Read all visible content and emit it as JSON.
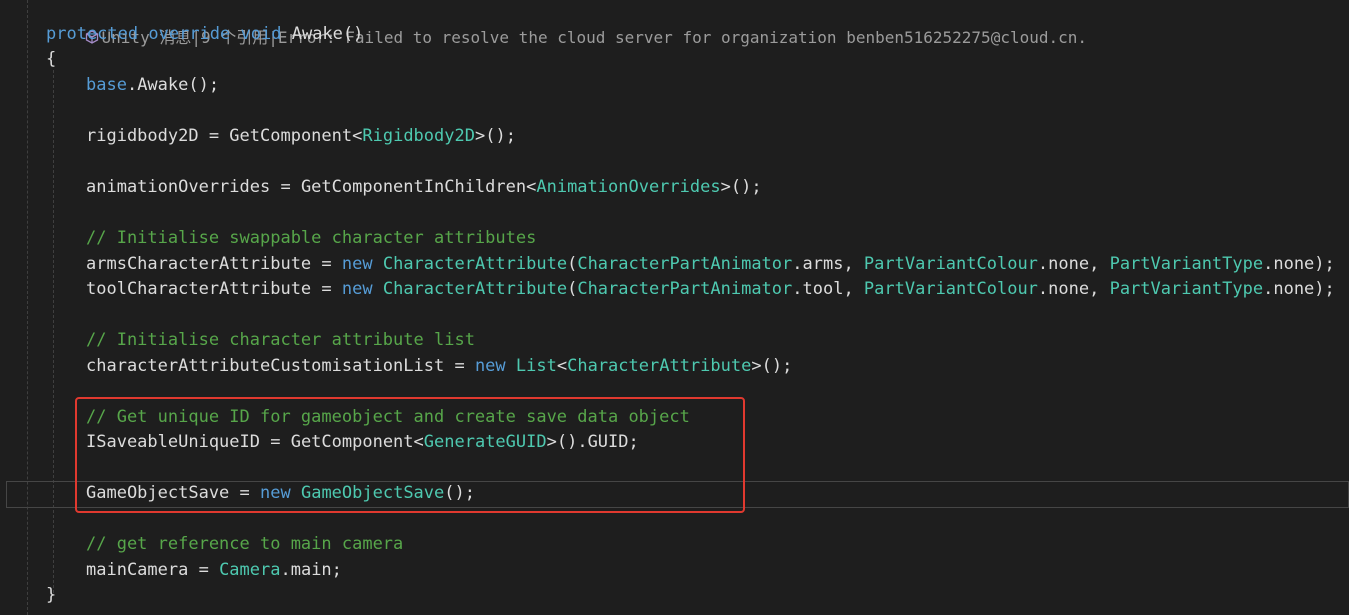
{
  "codelens": {
    "icon": "unity-cube-icon",
    "text": "Unity 消息|9 个引用|Error: Failed to resolve the cloud server for organization benben516252275@cloud.cn."
  },
  "code": {
    "signature": {
      "kw1": "protected",
      "kw2": "override",
      "kw3": "void",
      "name": "Awake",
      "parens": "()"
    },
    "open_brace": "{",
    "base_awake": {
      "kw": "base",
      "rest": ".Awake();"
    },
    "rigidbody": {
      "lhs": "rigidbody2D = ",
      "method": "GetComponent",
      "lt": "<",
      "type": "Rigidbody2D",
      "gt": ">",
      "tail": "();"
    },
    "animation": {
      "lhs": "animationOverrides = ",
      "method": "GetComponentInChildren",
      "lt": "<",
      "type": "AnimationOverrides",
      "gt": ">",
      "tail": "();"
    },
    "comment_swappable": "// Initialise swappable character attributes",
    "arms": {
      "lhs": "armsCharacterAttribute = ",
      "kw": "new",
      "ctor": "CharacterAttribute",
      "p1": "(",
      "t1": "CharacterPartAnimator",
      "m1": ".arms, ",
      "t2": "PartVariantColour",
      "m2": ".none, ",
      "t3": "PartVariantType",
      "m3": ".none);"
    },
    "tool": {
      "lhs": "toolCharacterAttribute = ",
      "kw": "new",
      "ctor": "CharacterAttribute",
      "p1": "(",
      "t1": "CharacterPartAnimator",
      "m1": ".tool, ",
      "t2": "PartVariantColour",
      "m2": ".none, ",
      "t3": "PartVariantType",
      "m3": ".none);"
    },
    "comment_list": "// Initialise character attribute list",
    "customisation": {
      "lhs": "characterAttributeCustomisationList = ",
      "kw": "new",
      "type1": "List",
      "lt": "<",
      "type2": "CharacterAttribute",
      "gt": ">",
      "tail": "();"
    },
    "comment_guid": "// Get unique ID for gameobject and create save data object",
    "guid": {
      "lhs": "ISaveableUniqueID = ",
      "method": "GetComponent",
      "lt": "<",
      "type": "GenerateGUID",
      "gt": ">",
      "tail": "().GUID;"
    },
    "gamesave": {
      "lhs": "GameObjectSave = ",
      "kw": "new",
      "type": "GameObjectSave",
      "tail": "();"
    },
    "comment_camera": "// get reference to main camera",
    "camera": {
      "lhs": "mainCamera = ",
      "type": "Camera",
      "tail": ".main;"
    },
    "close_brace": "}"
  },
  "colors": {
    "background": "#1e1e1e",
    "keyword": "#569cd6",
    "type": "#4ec9b0",
    "comment": "#57a64a",
    "text": "#dcdcdc",
    "highlight_box": "#e0392f"
  }
}
